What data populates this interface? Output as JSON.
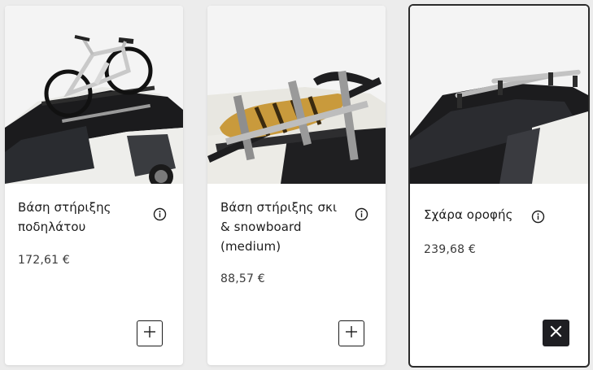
{
  "products": [
    {
      "title": "Βάση στήριξης ποδηλάτου",
      "price": "172,61 €",
      "image_icon": "bike-carrier-image",
      "action": "add",
      "selected": false
    },
    {
      "title": "Βάση στήριξης σκι & snowboard (medium)",
      "price": "88,57 €",
      "image_icon": "ski-snowboard-carrier-image",
      "action": "add",
      "selected": false
    },
    {
      "title": "Σχάρα οροφής",
      "price": "239,68 €",
      "image_icon": "roof-rack-image",
      "action": "remove",
      "selected": true
    }
  ],
  "icons": {
    "info": "info-icon",
    "add": "plus-icon",
    "remove": "close-icon"
  },
  "colors": {
    "background": "#ececec",
    "card": "#ffffff",
    "selected_border": "#2b2b2b",
    "remove_button": "#1f1f23",
    "text": "#1c1c1c"
  }
}
